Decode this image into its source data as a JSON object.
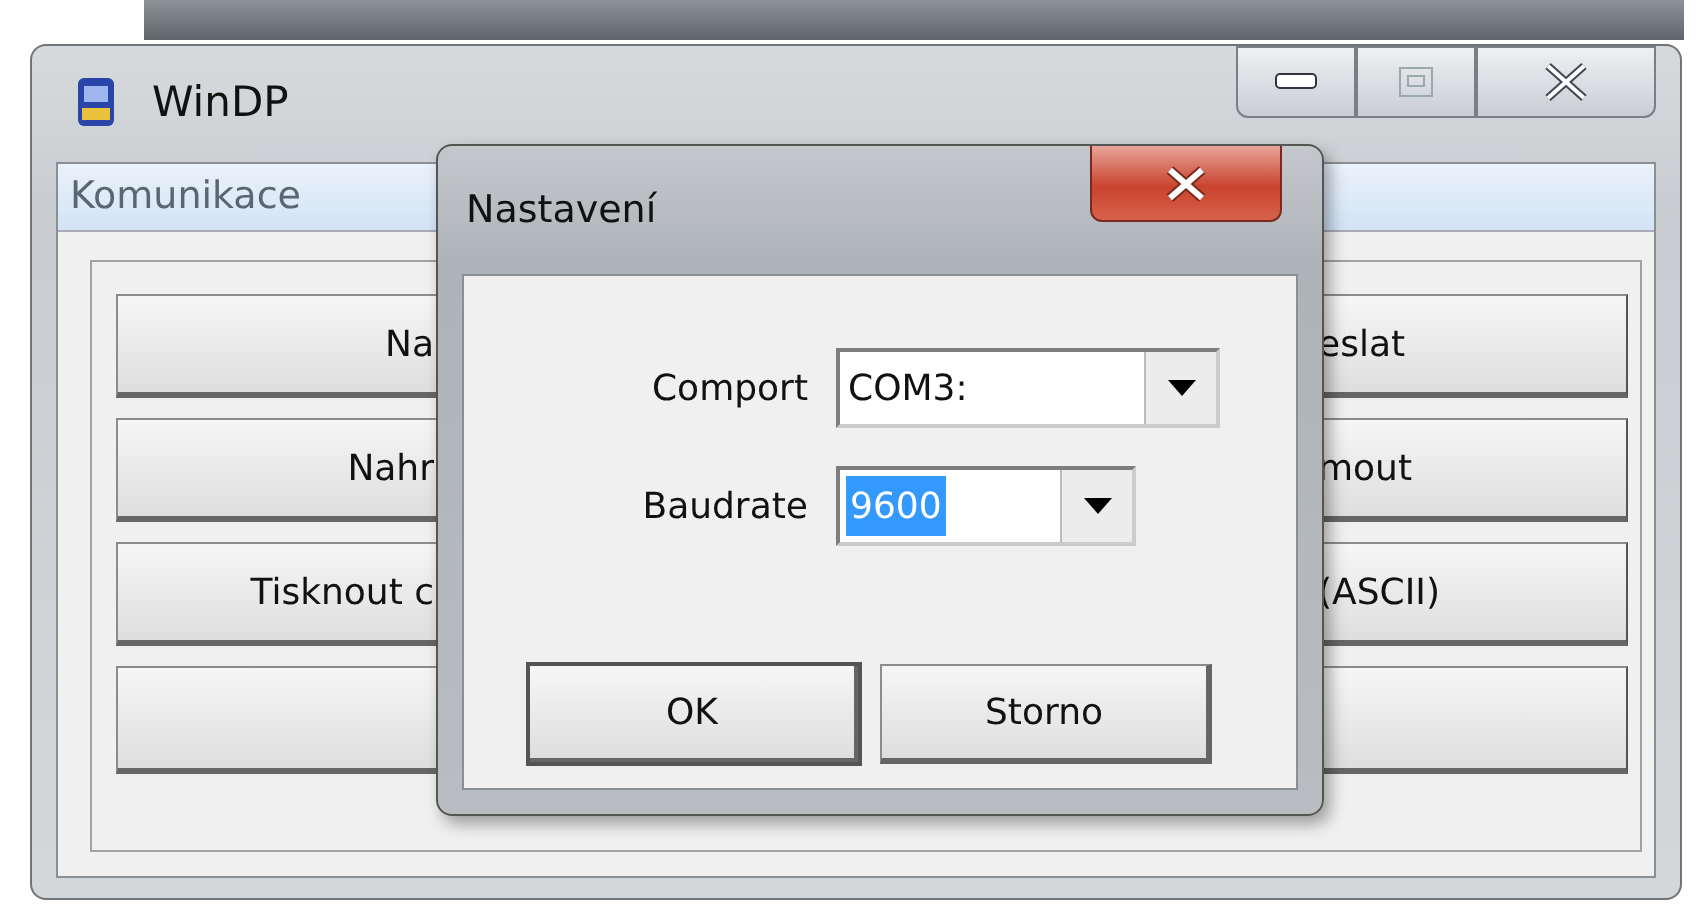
{
  "window": {
    "title": "WinDP"
  },
  "tab": {
    "label": "Komunikace",
    "selected": true
  },
  "buttons": [
    {
      "kind": "labelled",
      "left_text": "Na",
      "right_text": "eslat"
    },
    {
      "kind": "labelled",
      "left_text": "Nahr",
      "right_text": "mout"
    },
    {
      "kind": "labelled",
      "left_text": "Tisknout c",
      "right_text": "(ASCII)"
    },
    {
      "kind": "blank"
    }
  ],
  "dialog": {
    "title": "Nastavení",
    "fields": [
      {
        "label": "Comport",
        "value": "COM3:",
        "selected": false
      },
      {
        "label": "Baudrate",
        "value": "9600",
        "selected": true
      }
    ],
    "buttons": [
      {
        "label": "OK",
        "default": true
      },
      {
        "label": "Storno",
        "default": false
      }
    ]
  }
}
